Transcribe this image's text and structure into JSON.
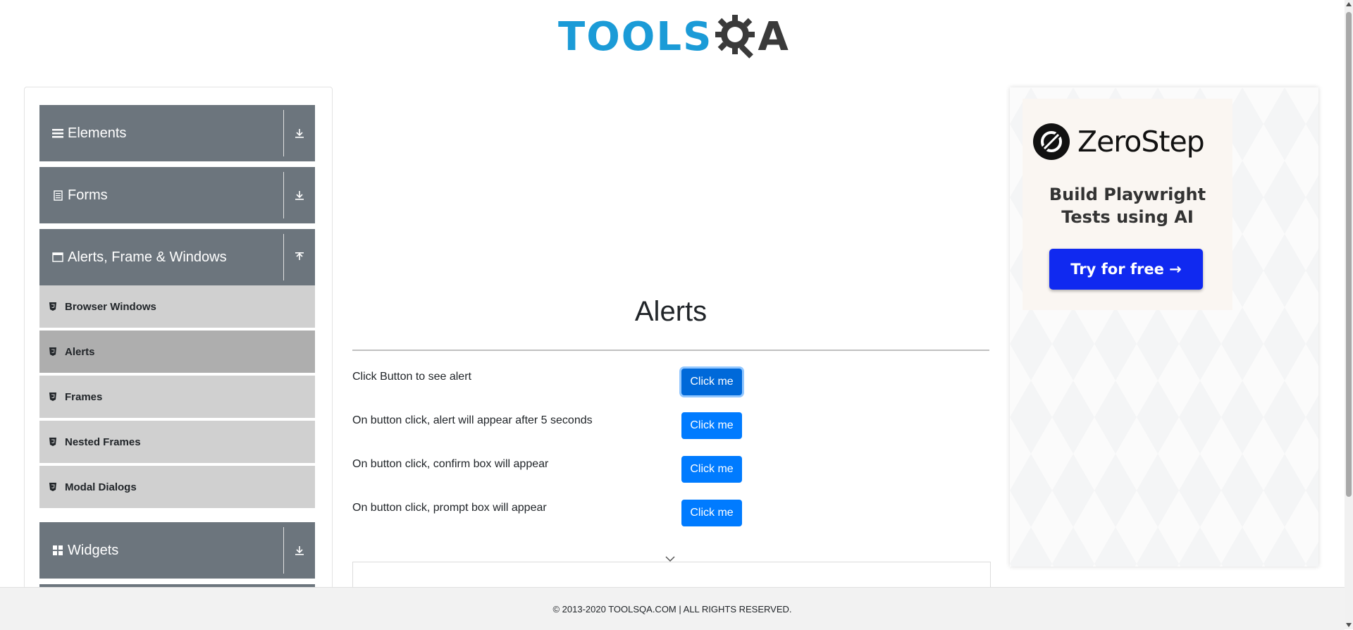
{
  "header": {
    "logo_tools": "TOOLS",
    "logo_a": "A"
  },
  "sidebar": {
    "groups": [
      {
        "label": "Elements",
        "icon": "hamburger-icon",
        "arrow": "download-arrow-icon"
      },
      {
        "label": "Forms",
        "icon": "document-icon",
        "arrow": "download-arrow-icon"
      },
      {
        "label": "Alerts, Frame & Windows",
        "icon": "window-icon",
        "arrow": "upload-arrow-icon"
      },
      {
        "label": "Widgets",
        "icon": "widgets-grid-icon",
        "arrow": "download-arrow-icon"
      }
    ],
    "items": [
      {
        "label": "Browser Windows",
        "active": false
      },
      {
        "label": "Alerts",
        "active": true
      },
      {
        "label": "Frames",
        "active": false
      },
      {
        "label": "Nested Frames",
        "active": false
      },
      {
        "label": "Modal Dialogs",
        "active": false
      }
    ]
  },
  "main": {
    "title": "Alerts",
    "rows": [
      {
        "label": "Click Button to see alert",
        "button": "Click me"
      },
      {
        "label": "On button click, alert will appear after 5 seconds",
        "button": "Click me"
      },
      {
        "label": "On button click, confirm box will appear",
        "button": "Click me"
      },
      {
        "label": "On button click, prompt box will appear",
        "button": "Click me"
      }
    ]
  },
  "ad": {
    "brand": "ZeroStep",
    "tagline_line1": "Build Playwright",
    "tagline_line2": "Tests using AI",
    "cta": "Try for free →"
  },
  "footer": {
    "text": "© 2013-2020 TOOLSQA.COM | ALL RIGHTS RESERVED."
  },
  "colors": {
    "primary": "#007bff",
    "sidebar_header": "#6c757d",
    "submenu": "#d0d0d0",
    "submenu_active": "#aeaeae",
    "logo_blue": "#1b9bd7",
    "ad_cta": "#1029f0"
  }
}
